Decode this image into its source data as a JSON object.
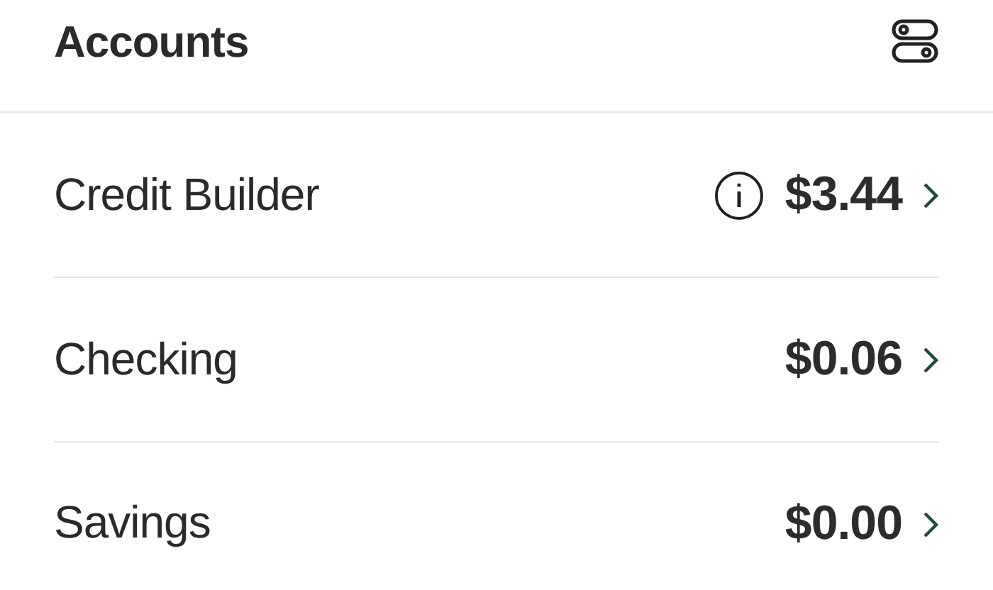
{
  "header": {
    "title": "Accounts"
  },
  "accounts": [
    {
      "name": "Credit Builder",
      "amount": "$3.44",
      "info": true
    },
    {
      "name": "Checking",
      "amount": "$0.06",
      "info": false
    },
    {
      "name": "Savings",
      "amount": "$0.00",
      "info": false
    }
  ]
}
